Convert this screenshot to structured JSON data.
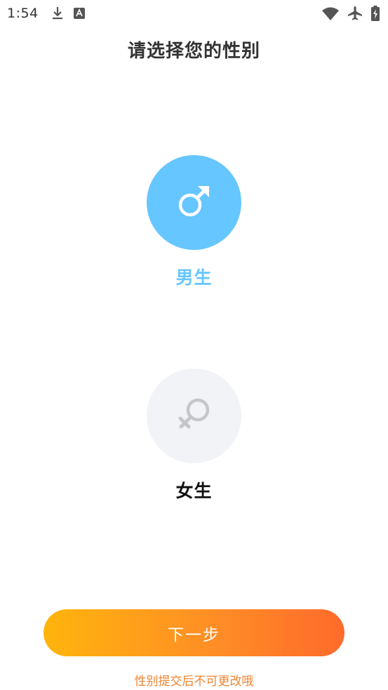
{
  "status_bar": {
    "time": "1:54",
    "icons": [
      "download-icon",
      "app-notification-icon",
      "wifi-icon",
      "airplane-mode-icon",
      "battery-charging-icon"
    ]
  },
  "page": {
    "title": "请选择您的性别"
  },
  "options": {
    "male": {
      "label": "男生",
      "icon": "male-symbol-icon",
      "selected": true,
      "color": "#66c6ff"
    },
    "female": {
      "label": "女生",
      "icon": "female-symbol-icon",
      "selected": false,
      "color": "#f1f3f6"
    }
  },
  "next_button": {
    "label": "下一步",
    "gradient": [
      "#ffb40d",
      "#ff6a2b"
    ]
  },
  "hint": {
    "text": "性别提交后不可更改哦",
    "color": "#f08432"
  }
}
